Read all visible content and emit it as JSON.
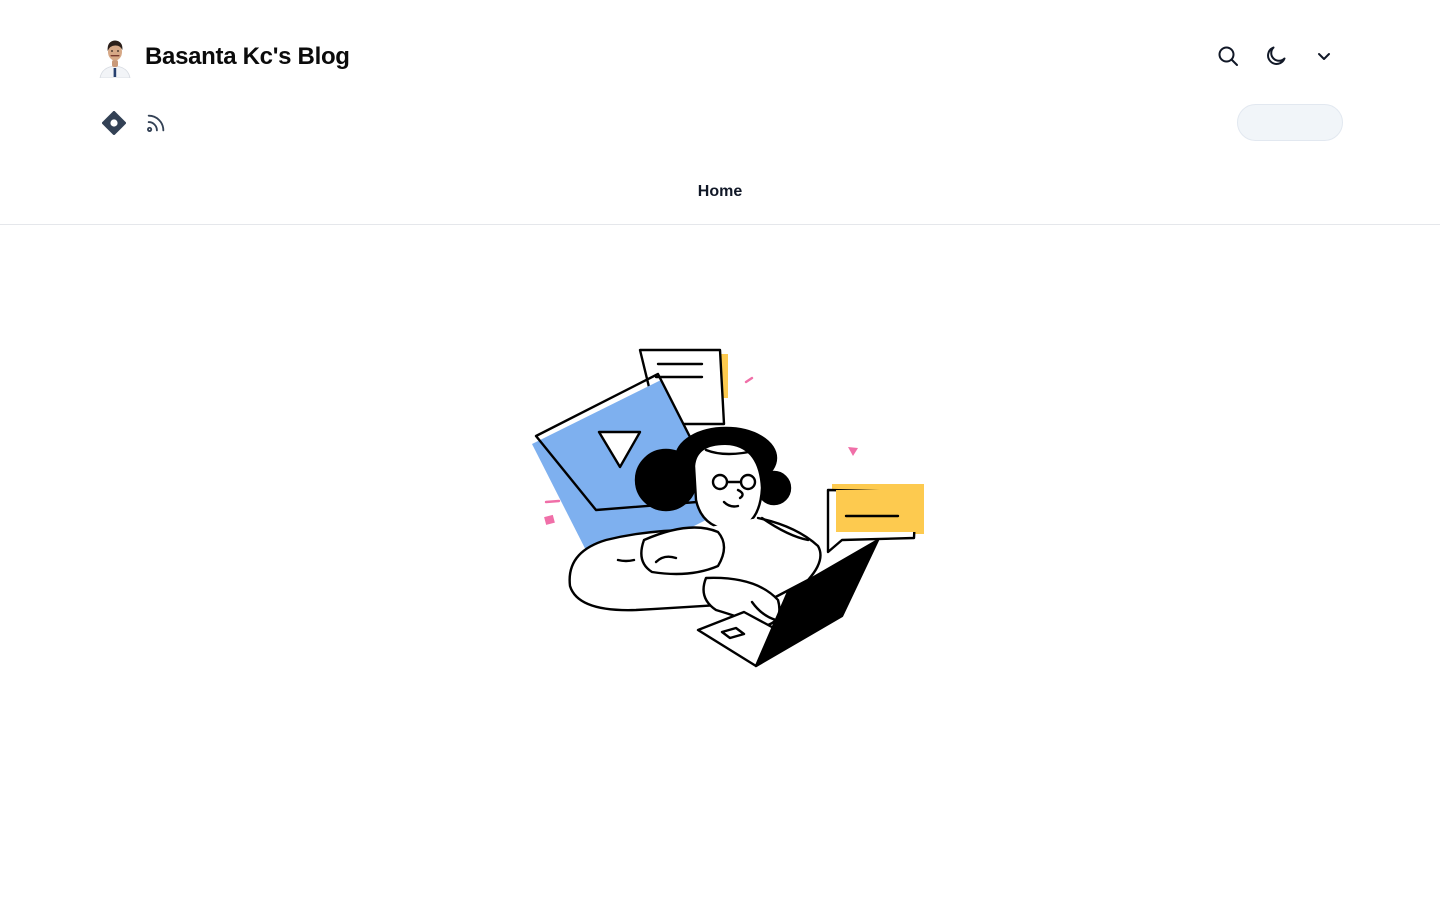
{
  "header": {
    "blog_title": "Basanta Kc's Blog"
  },
  "icons": {
    "search": "search-icon",
    "theme": "moon-icon",
    "menu": "chevron-down-icon",
    "social_1": "hashnode-icon",
    "social_2": "rss-icon"
  },
  "nav": {
    "items": [
      {
        "label": "Home"
      }
    ]
  },
  "colors": {
    "accent_blue": "#7eb0ef",
    "accent_yellow": "#fdca4f",
    "accent_pink": "#f06fa8",
    "icon_dark": "#334155",
    "pill_bg": "#f1f5f9",
    "divider": "#e5e7eb"
  }
}
